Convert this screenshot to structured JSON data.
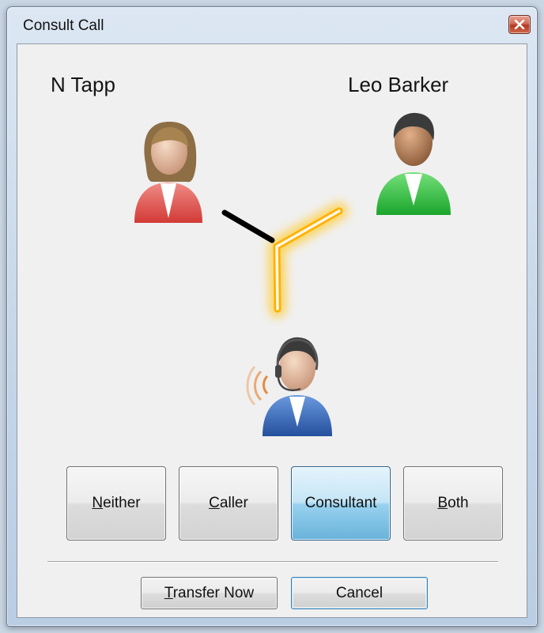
{
  "window": {
    "title": "Consult Call",
    "close_icon": "close-icon"
  },
  "parties": {
    "caller": {
      "name": "N Tapp",
      "icon": "person-female-icon",
      "shirt_color": "#e9514f"
    },
    "consultant": {
      "name": "Leo Barker",
      "icon": "person-male-icon",
      "shirt_color": "#22c23a"
    },
    "agent": {
      "icon": "agent-headset-icon",
      "shirt_color": "#2f62b3"
    }
  },
  "connection": {
    "caller_line_color": "#000000",
    "consultant_line_color": "#f5b400",
    "agent_line_color": "#f5b400"
  },
  "talk_to": {
    "selected": "Consultant",
    "options": [
      {
        "id": "neither",
        "mnemonic": "N",
        "rest": "either"
      },
      {
        "id": "caller",
        "mnemonic": "C",
        "rest": "aller"
      },
      {
        "id": "consultant",
        "mnemonic": "",
        "rest": "Consultant"
      },
      {
        "id": "both",
        "mnemonic": "B",
        "rest": "oth"
      }
    ]
  },
  "actions": {
    "transfer_mnemonic": "T",
    "transfer_rest": "ransfer Now",
    "cancel_label": "Cancel"
  }
}
